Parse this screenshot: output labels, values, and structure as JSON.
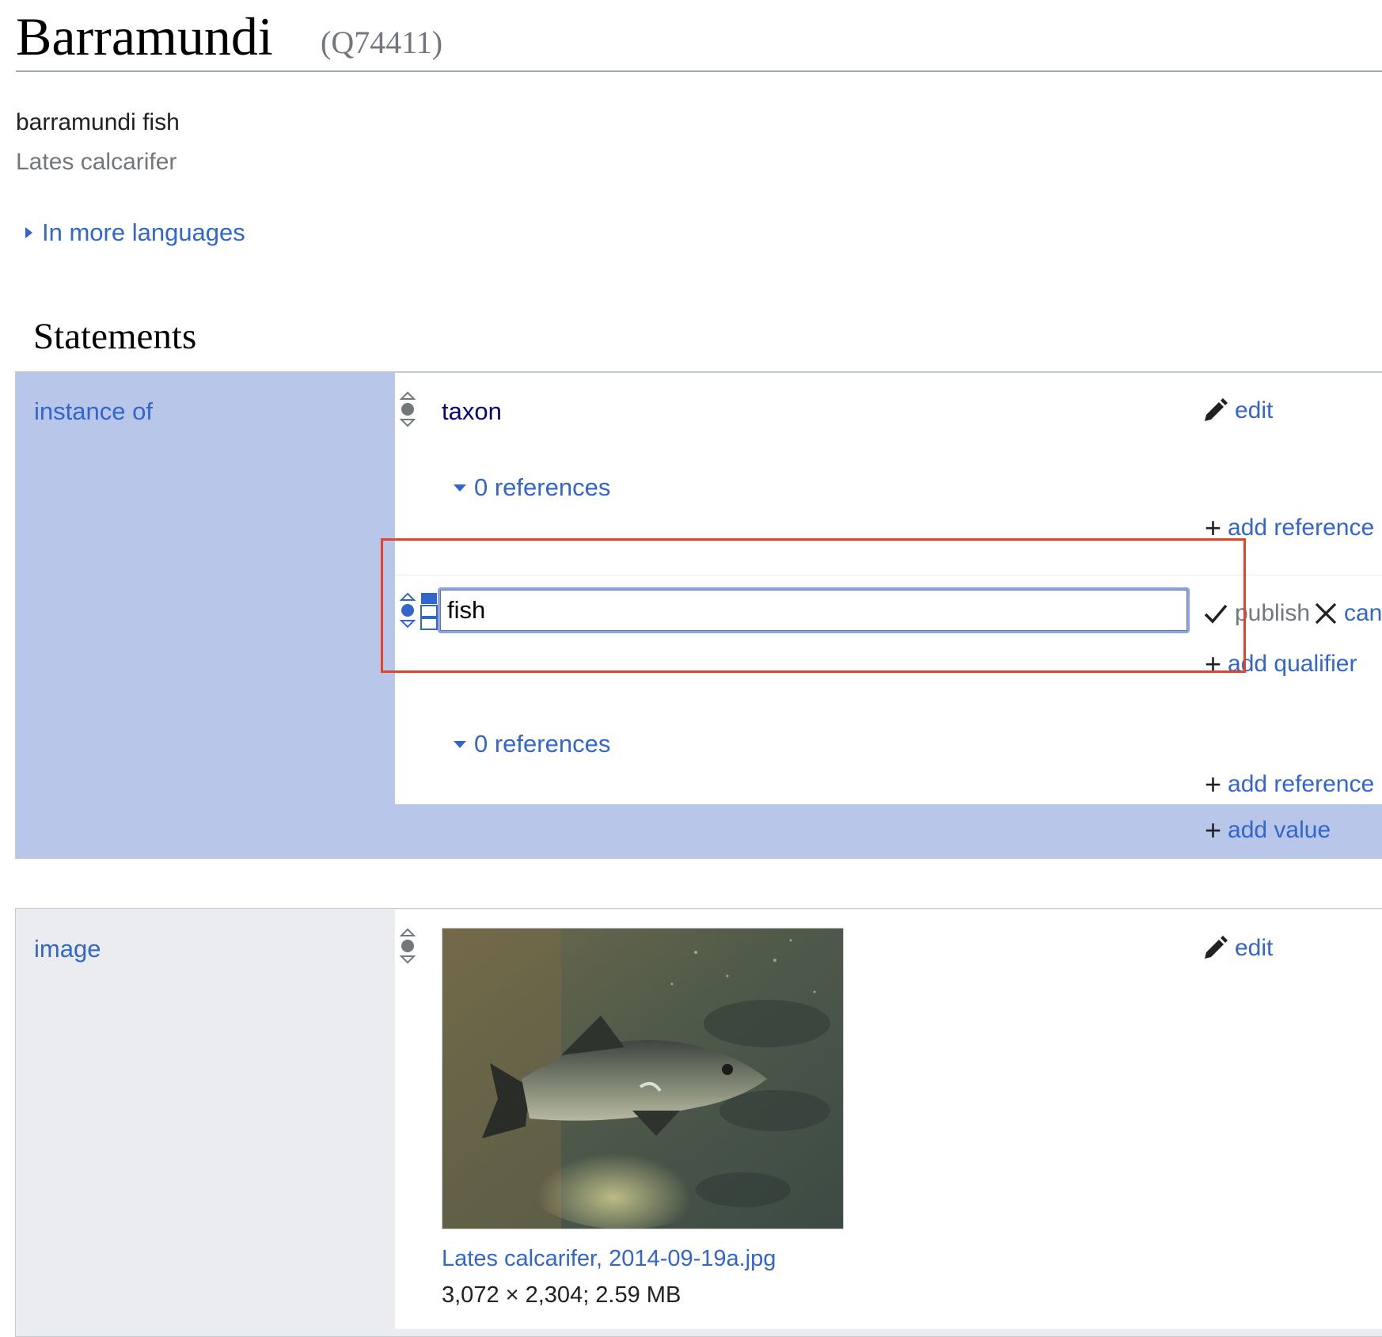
{
  "header": {
    "title": "Barramundi",
    "id": "(Q74411)",
    "label": "barramundi fish",
    "description": "Lates calcarifer",
    "more_languages": "In more languages"
  },
  "statements_heading": "Statements",
  "statement_groups": [
    {
      "property": "instance of",
      "values": [
        {
          "value": "taxon",
          "edit_label": "edit",
          "references": "0 references",
          "add_reference": "add reference"
        },
        {
          "input_value": "fish",
          "publish_label": "publish",
          "cancel_label": "can",
          "add_qualifier": "add qualifier",
          "references": "0 references",
          "add_reference": "add reference"
        }
      ],
      "add_value": "add value"
    },
    {
      "property": "image",
      "edit_label": "edit",
      "file_name": "Lates calcarifer, 2014-09-19a.jpg",
      "file_meta": "3,072 × 2,304; 2.59 MB"
    }
  ],
  "colors": {
    "link": "#3366cc",
    "group_active": "#b8c7e9",
    "group_inactive": "#eaecf0",
    "highlight_box": "#e2432a"
  }
}
